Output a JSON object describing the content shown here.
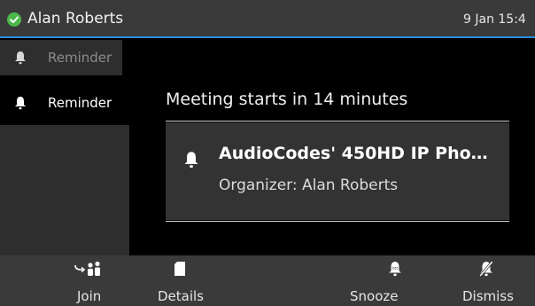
{
  "status_bar": {
    "user_name": "Alan Roberts",
    "datetime": "9 Jan 15:4",
    "presence": "available",
    "accent_color": "#2a8fd8"
  },
  "sidebar": {
    "items": [
      {
        "label": "Reminder",
        "icon": "bell-icon",
        "state": "inactive"
      },
      {
        "label": "Reminder",
        "icon": "bell-icon",
        "state": "active"
      }
    ]
  },
  "reminder": {
    "title": "Meeting starts in 14 minutes",
    "meeting_subject": "AudioCodes' 450HD IP Pho…",
    "organizer": "Organizer: Alan Roberts"
  },
  "softkeys": [
    {
      "label": "Join",
      "icon": "join-meeting-icon"
    },
    {
      "label": "Details",
      "icon": "details-icon"
    },
    {
      "label": "Snooze",
      "icon": "snooze-icon"
    },
    {
      "label": "Dismiss",
      "icon": "dismiss-bell-icon"
    }
  ]
}
